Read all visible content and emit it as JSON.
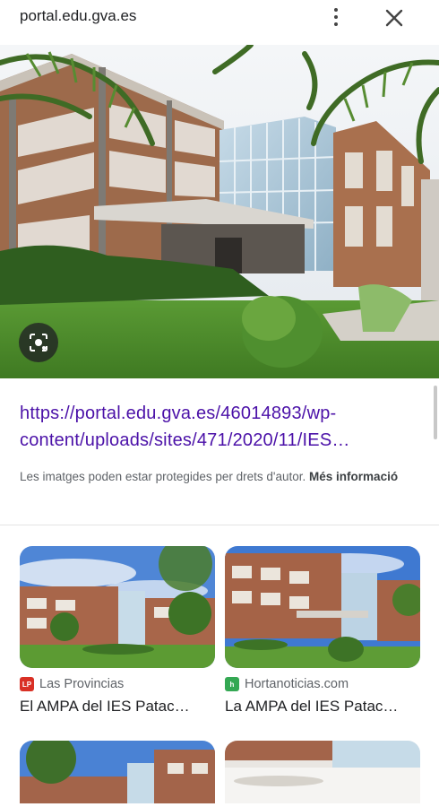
{
  "header": {
    "domain": "portal.edu.gva.es",
    "more_icon": "more-vert-icon",
    "close_icon": "close-icon"
  },
  "hero": {
    "lens_icon": "lens-icon"
  },
  "result": {
    "url": "https://portal.edu.gva.es/46014893/wp-content/uploads/sites/471/2020/11/IES…",
    "notice": "Les imatges poden estar protegides per drets d'autor.",
    "more_info": "Més informació"
  },
  "related": [
    {
      "source": "Las Provincias",
      "source_icon_text": "LP",
      "source_color": "#d93025",
      "title": "El AMPA del IES Patac…"
    },
    {
      "source": "Hortanoticias.com",
      "source_icon_text": "h",
      "source_color": "#34a853",
      "title": "La AMPA del IES Patac…"
    }
  ]
}
